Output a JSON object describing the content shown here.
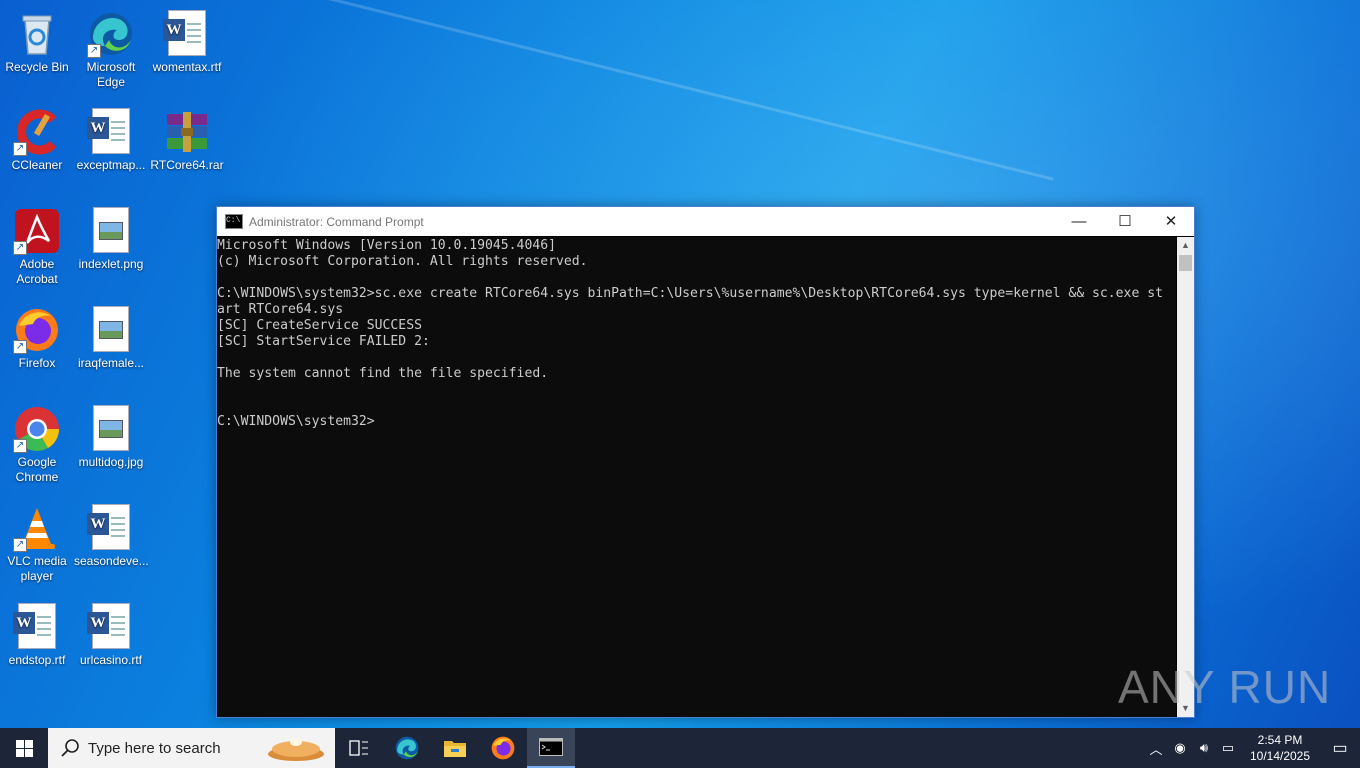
{
  "desktop": {
    "icons": [
      {
        "label": "Recycle Bin",
        "icon": "recycle-bin-icon"
      },
      {
        "label": "Microsoft Edge",
        "icon": "edge-icon"
      },
      {
        "label": "womentax.rtf",
        "icon": "word-document-icon"
      },
      {
        "label": "CCleaner",
        "icon": "ccleaner-icon"
      },
      {
        "label": "exceptmap...",
        "icon": "word-document-icon"
      },
      {
        "label": "RTCore64.rar",
        "icon": "winrar-archive-icon"
      },
      {
        "label": "Adobe Acrobat",
        "icon": "acrobat-icon"
      },
      {
        "label": "indexlet.png",
        "icon": "image-file-icon"
      },
      {
        "label": "Firefox",
        "icon": "firefox-icon"
      },
      {
        "label": "iraqfemale...",
        "icon": "image-file-icon"
      },
      {
        "label": "Google Chrome",
        "icon": "chrome-icon"
      },
      {
        "label": "multidog.jpg",
        "icon": "image-file-icon"
      },
      {
        "label": "VLC media player",
        "icon": "vlc-icon"
      },
      {
        "label": "seasondeve...",
        "icon": "word-document-icon"
      },
      {
        "label": "endstop.rtf",
        "icon": "word-document-icon"
      },
      {
        "label": "urlcasino.rtf",
        "icon": "word-document-icon"
      }
    ]
  },
  "window": {
    "title": "Administrator: Command Prompt",
    "minimize": "—",
    "maximize": "☐",
    "close": "✕",
    "console_text": "Microsoft Windows [Version 10.0.19045.4046]\n(c) Microsoft Corporation. All rights reserved.\n\nC:\\WINDOWS\\system32>sc.exe create RTCore64.sys binPath=C:\\Users\\%username%\\Desktop\\RTCore64.sys type=kernel && sc.exe st\nart RTCore64.sys\n[SC] CreateService SUCCESS\n[SC] StartService FAILED 2:\n\nThe system cannot find the file specified.\n\n\nC:\\WINDOWS\\system32>"
  },
  "watermark": "ANY RUN",
  "taskbar": {
    "search_placeholder": "Type here to search",
    "pinned": [
      "task-view-icon",
      "edge-icon",
      "file-explorer-icon",
      "firefox-icon",
      "command-prompt-icon"
    ],
    "clock_time": "2:54 PM",
    "clock_date": "10/14/2025"
  }
}
